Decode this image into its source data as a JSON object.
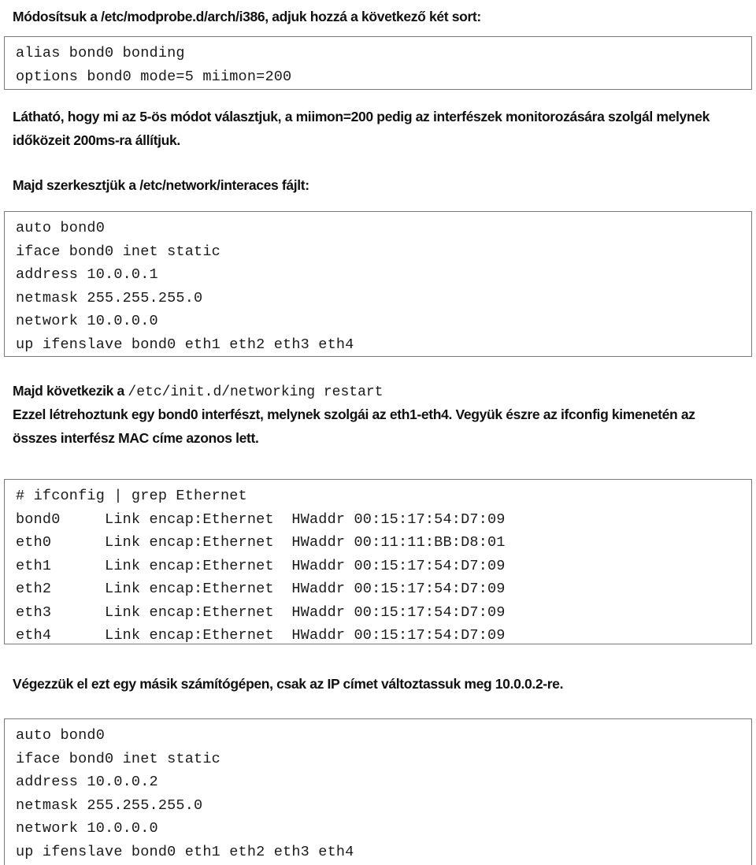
{
  "document": {
    "language": "hu",
    "paragraphs": {
      "modprobe_intro": "Módosítsuk a /etc/modprobe.d/arch/i386, adjuk hozzá a következő két sort:",
      "lathato": "Látható, hogy mi az 5-ös módot választjuk, a miimon=200 pedig az interfészek monitorozására szolgál melynek időközeit 200ms-ra állítjuk.",
      "majd_szerkesztjuk": "Majd szerkesztjük a /etc/network/interaces fájlt:",
      "majd_kovetkezik_prefix": "Majd következik a ",
      "majd_kovetkezik_code": "/etc/init.d/networking restart",
      "ezzel": "Ezzel létrehoztunk egy bond0 interfészt, melynek szolgái az eth1-eth4. Vegyük észre az ifconfig kimenetén az összes interfész MAC címe azonos lett.",
      "vegezzuk": "Végezzük el ezt egy másik számítógépen, csak az IP címet változtassuk meg 10.0.0.2-re."
    },
    "code_blocks": {
      "modprobe": {
        "lines": [
          "alias bond0 bonding",
          "options bond0 mode=5 miimon=200"
        ]
      },
      "interfaces": {
        "lines": [
          "auto bond0",
          "iface bond0 inet static",
          "address 10.0.0.1",
          "netmask 255.255.255.0",
          "network 10.0.0.0",
          "up ifenslave bond0 eth1 eth2 eth3 eth4"
        ]
      },
      "ifconfig": {
        "lines": [
          "# ifconfig | grep Ethernet",
          "bond0     Link encap:Ethernet  HWaddr 00:15:17:54:D7:09",
          "eth0      Link encap:Ethernet  HWaddr 00:11:11:BB:D8:01",
          "eth1      Link encap:Ethernet  HWaddr 00:15:17:54:D7:09",
          "eth2      Link encap:Ethernet  HWaddr 00:15:17:54:D7:09",
          "eth3      Link encap:Ethernet  HWaddr 00:15:17:54:D7:09",
          "eth4      Link encap:Ethernet  HWaddr 00:15:17:54:D7:09"
        ]
      },
      "interfaces2": {
        "lines": [
          "auto bond0",
          "iface bond0 inet static",
          "address 10.0.0.2",
          "netmask 255.255.255.0",
          "network 10.0.0.0",
          "up ifenslave bond0 eth1 eth2 eth3 eth4"
        ]
      }
    },
    "colors": {
      "box_border": "#7a7a7a",
      "text": "#101010",
      "code_text": "#1a1a1a",
      "background": "#ffffff"
    }
  }
}
